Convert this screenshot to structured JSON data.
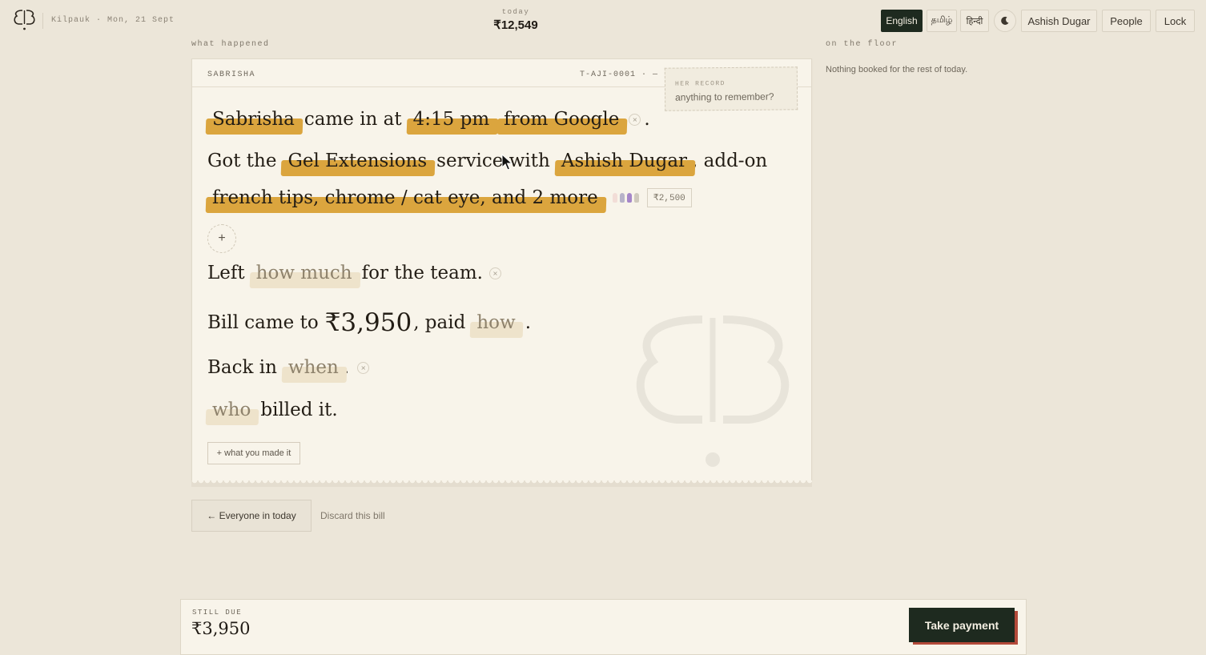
{
  "topbar": {
    "location": "Kilpauk · Mon, 21 Sept",
    "today_label": "today",
    "today_value": "₹12,549",
    "languages": [
      "English",
      "தமிழ்",
      "हिन्दी"
    ],
    "active_language": "English",
    "user": "Ashish Dugar",
    "people": "People",
    "lock": "Lock"
  },
  "sections": {
    "left_caption": "what happened",
    "right_caption": "on the floor",
    "floor_empty": "Nothing booked for the rest of today."
  },
  "card": {
    "client": "SABRISHA",
    "ticket": "T-AJI-0001 · —",
    "note_label": "HER RECORD",
    "note_placeholder": "anything to remember?",
    "line1": {
      "name": "Sabrisha",
      "t1": "came in at",
      "time": "4:15 pm",
      "source": "from Google",
      "end": "."
    },
    "line2": {
      "t1": "Got the",
      "service": "Gel Extensions",
      "t2": "service with",
      "staff": "Ashish Dugar",
      "t3": ", add-on"
    },
    "line3": {
      "addons": "french tips, chrome / cat eye, and 2 more",
      "price": "₹2,500"
    },
    "add_symbol": "+",
    "line4": {
      "t1": "Left",
      "tip": "how much",
      "t2": "for the team."
    },
    "line5": {
      "t1": "Bill came to",
      "amount": "₹3,950",
      "t2": ", paid",
      "method": "how",
      "end": "."
    },
    "line6": {
      "t1": "Back in",
      "when": "when",
      "end": "."
    },
    "line7": {
      "who": "who",
      "t1": "billed it."
    },
    "made_button": "+ what you made it",
    "clear_symbol": "×"
  },
  "actions": {
    "back": "← Everyone in today",
    "discard": "Discard this bill"
  },
  "footer": {
    "due_label": "STILL DUE",
    "due_value": "₹3,950",
    "pay_button": "Take payment"
  },
  "colors": {
    "accent_chip": "#dba53e",
    "dark_button": "#1e2a1f",
    "pay_shadow": "#b34a3a",
    "background": "#ece6d9",
    "card": "#f8f4ea"
  },
  "swatch_colors": [
    "#f2ddd7",
    "#b7b2c9",
    "#a586c9",
    "#cfc9bd"
  ]
}
